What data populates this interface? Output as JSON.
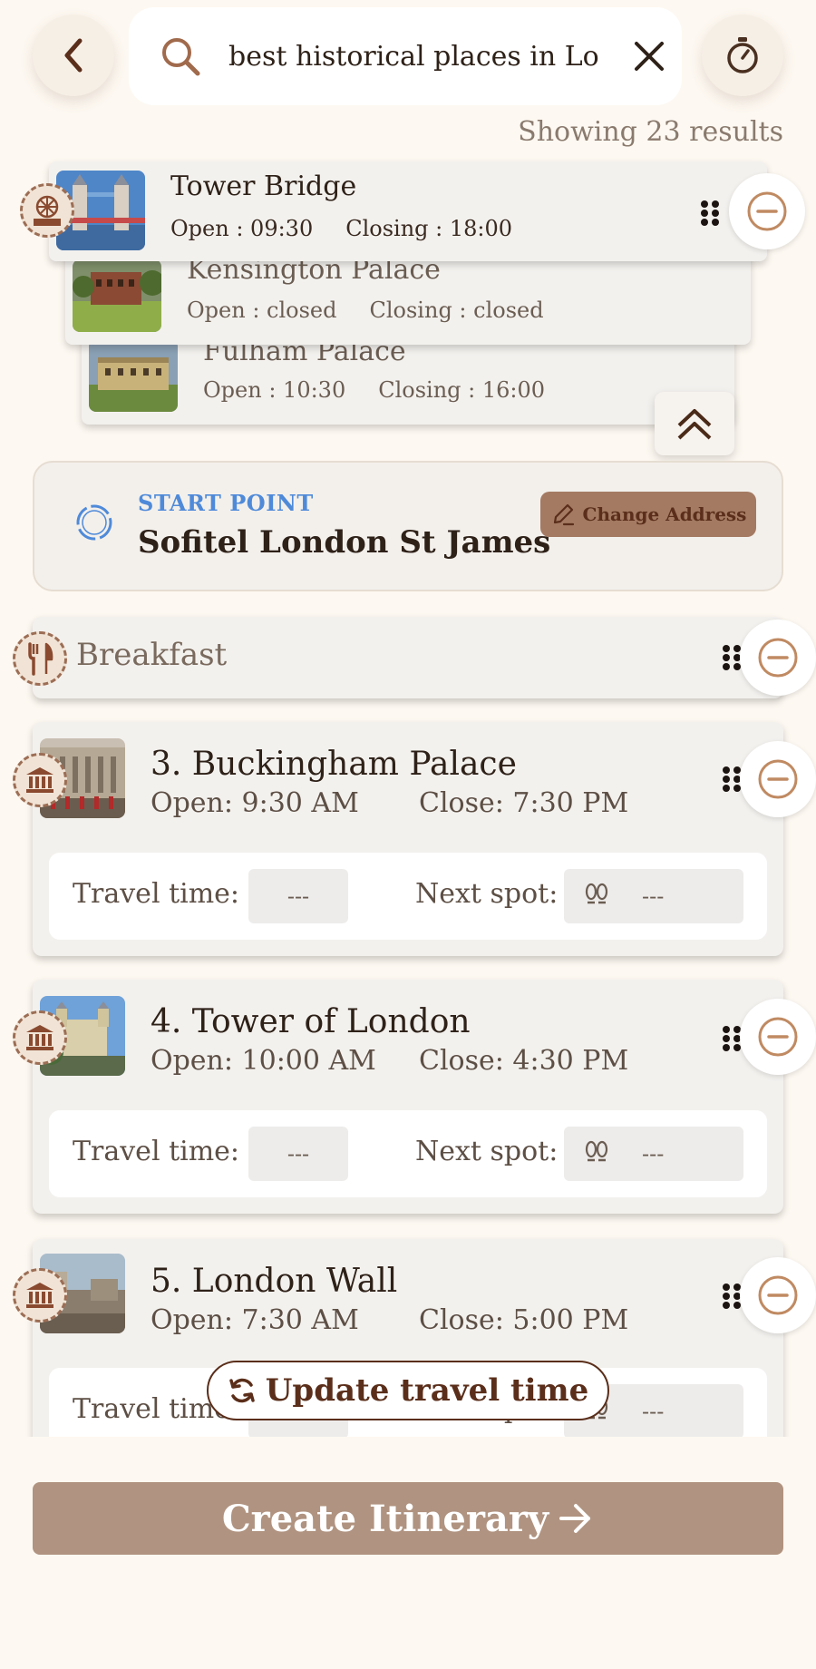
{
  "search": {
    "query": "best historical places in Lo",
    "results_count": "Showing 23 results"
  },
  "results": [
    {
      "title": "Tower Bridge",
      "open": "Open : 09:30",
      "closing": "Closing : 18:00"
    },
    {
      "title": "Kensington Palace",
      "open": "Open : closed",
      "closing": "Closing : closed"
    },
    {
      "title": "Fulham Palace",
      "open": "Open : 10:30",
      "closing": "Closing : 16:00"
    }
  ],
  "start_point": {
    "label": "START POINT",
    "name": "Sofitel London St James",
    "change_label": "Change Address"
  },
  "itinerary": {
    "meal_label": "Breakfast",
    "travel_label": "Travel time:",
    "next_label": "Next spot:",
    "stops": [
      {
        "title": "3. Buckingham Palace",
        "open": "Open: 9:30 AM",
        "close": "Close: 7:30 PM",
        "travel": "---",
        "next": "---"
      },
      {
        "title": "4. Tower of London",
        "open": "Open: 10:00 AM",
        "close": "Close: 4:30 PM",
        "travel": "---",
        "next": "---"
      },
      {
        "title": "5. London Wall",
        "open": "Open: 7:30 AM",
        "close": "Close: 5:00 PM",
        "travel": "---",
        "next": "---"
      }
    ]
  },
  "actions": {
    "update_travel_time": "Update travel time",
    "create_itinerary": "Create Itinerary"
  },
  "icons": {
    "back": "chevron-left-icon",
    "search": "search-icon",
    "clear": "close-icon",
    "timer": "stopwatch-icon",
    "attraction": "ferris-wheel-icon",
    "landmark": "museum-icon",
    "meal": "cutlery-icon",
    "remove": "minus-circle-icon",
    "drag": "drag-handle-icon",
    "collapse": "chevron-double-up-icon",
    "start": "location-ring-icon",
    "edit": "pencil-icon",
    "walk": "footsteps-icon",
    "refresh": "refresh-icon",
    "arrow": "arrow-right-icon"
  },
  "colors": {
    "background": "#fdf8f1",
    "accent_brown": "#5a2e1a",
    "button_tan": "#b09380",
    "start_blue": "#4f8ad9",
    "remove_orange": "#c08a62"
  }
}
